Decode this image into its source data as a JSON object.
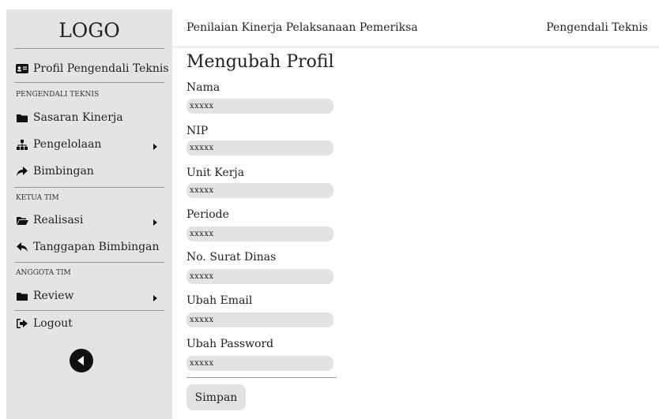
{
  "sidebar": {
    "logo": "LOGO",
    "profile_label": "Profil Pengendali Teknis",
    "section_pengendali": "PENGENDALI TEKNIS",
    "sasaran_label": "Sasaran Kinerja",
    "pengelolaan_label": "Pengelolaan",
    "bimbingan_label": "Bimbingan",
    "section_ketua": "KETUA TIM",
    "realisasi_label": "Realisasi",
    "tanggapan_label": "Tanggapan Bimbingan",
    "section_anggota": "ANGGOTA TIM",
    "review_label": "Review",
    "logout_label": "Logout"
  },
  "header": {
    "title": "Penilaian Kinerja Pelaksanaan Pemeriksa",
    "role": "Pengendali Teknis"
  },
  "form": {
    "heading": "Mengubah Profil",
    "fields": [
      {
        "label": "Nama",
        "value": "xxxxx"
      },
      {
        "label": "NIP",
        "value": "xxxxx"
      },
      {
        "label": "Unit Kerja",
        "value": "xxxxx"
      },
      {
        "label": "Periode",
        "value": "xxxxx"
      },
      {
        "label": "No. Surat Dinas",
        "value": "xxxxx"
      },
      {
        "label": "Ubah Email",
        "value": "xxxxx"
      },
      {
        "label": "Ubah Password",
        "value": "xxxxx"
      }
    ],
    "save_label": "Simpan"
  },
  "icons": {
    "profile": "id-card-icon",
    "sasaran": "folder-icon",
    "pengelolaan": "sitemap-icon",
    "bimbingan": "share-arrow-icon",
    "realisasi": "folder-open-icon",
    "tanggapan": "reply-icon",
    "review": "folder-icon",
    "logout": "sign-out-icon",
    "back": "circle-back-icon"
  }
}
